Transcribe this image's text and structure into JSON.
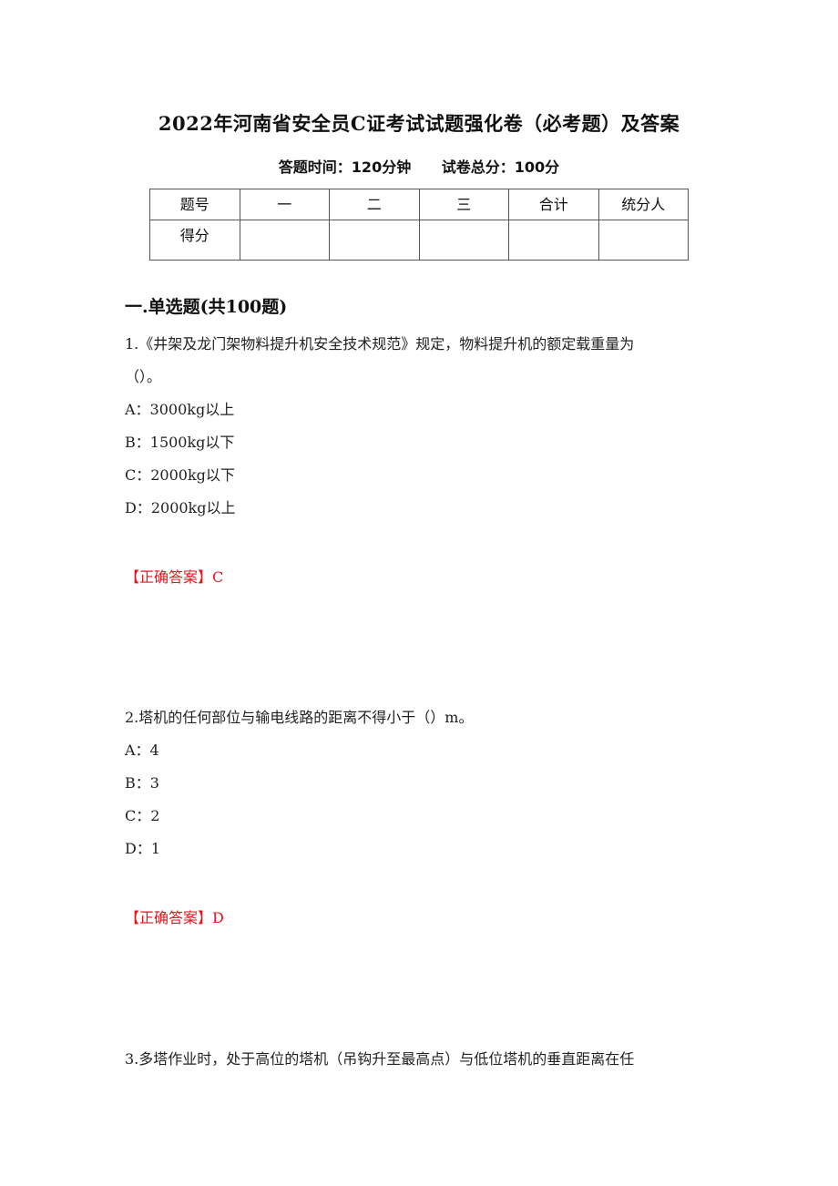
{
  "document": {
    "title": "2022年河南省安全员C证考试试题强化卷（必考题）及答案",
    "subtitle": {
      "time": "答题时间：120分钟",
      "total": "试卷总分：100分"
    },
    "score_table": {
      "header": [
        "题号",
        "一",
        "二",
        "三",
        "合计",
        "统分人"
      ],
      "row_label": "得分",
      "row_values": [
        "",
        "",
        "",
        "",
        ""
      ]
    },
    "section_title": "一.单选题(共100题)",
    "questions": [
      {
        "stem_line1": "1.《井架及龙门架物料提升机安全技术规范》规定，物料提升机的额定载重量为",
        "stem_line2": "（）。",
        "options": [
          "A：3000kg以上",
          "B：1500kg以下",
          "C：2000kg以下",
          "D：2000kg以上"
        ],
        "answer": "【正确答案】C"
      },
      {
        "stem_line1": "2.塔机的任何部位与输电线路的距离不得小于（）m。",
        "options": [
          "A：4",
          "B：3",
          "C：2",
          "D：1"
        ],
        "answer": "【正确答案】D"
      },
      {
        "stem_line1": "3.多塔作业时，处于高位的塔机（吊钩升至最高点）与低位塔机的垂直距离在任"
      }
    ],
    "colors": {
      "answer": "#e8141b",
      "text": "#222222"
    }
  }
}
